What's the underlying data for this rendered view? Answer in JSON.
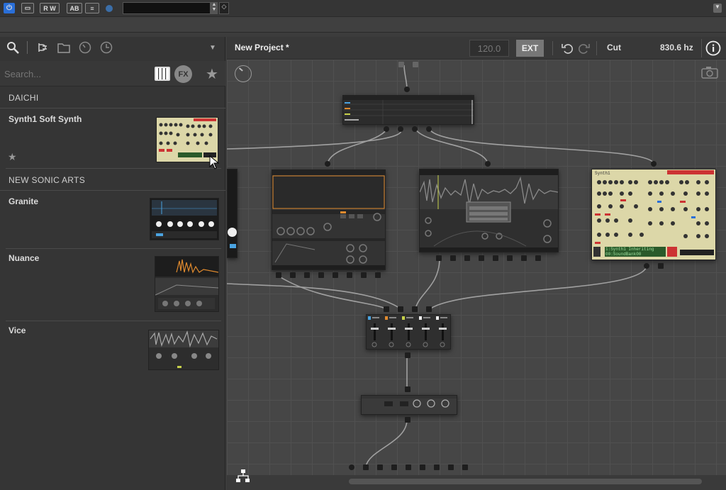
{
  "project": {
    "title": "New Project *"
  },
  "transport": {
    "tempo": "120.0",
    "sync_label": "EXT",
    "edit_label": "Cut",
    "frequency": "830.6 hz"
  },
  "sysbar": {
    "rw_label": "R W",
    "ab_label": "AB"
  },
  "search": {
    "placeholder": "Search...",
    "fx_label": "FX"
  },
  "library": {
    "sections": [
      {
        "vendor": "DAICHI",
        "items": [
          {
            "name": "Synth1 Soft Synth"
          }
        ]
      },
      {
        "vendor": "NEW SONIC ARTS",
        "items": [
          {
            "name": "Granite"
          },
          {
            "name": "Nuance"
          },
          {
            "name": "Vice"
          }
        ]
      }
    ]
  },
  "synth1_panel": {
    "title": "Synth1",
    "patch": "1:Synth1 Inheriting",
    "bank": "00:SoundBank00"
  },
  "colors": {
    "accent": "#e08a2e",
    "synth_panel": "#dcd7a8",
    "power_blue": "#2a6fd8",
    "lcd_green": "#2a5a2a"
  }
}
